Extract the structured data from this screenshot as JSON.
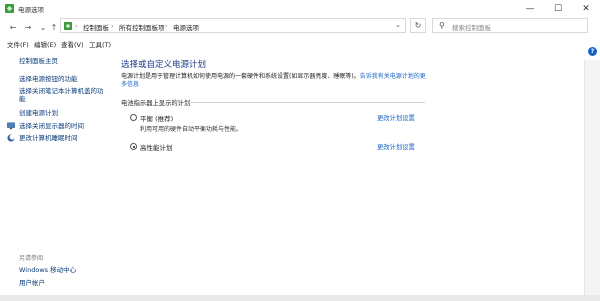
{
  "window": {
    "title": "电源选项"
  },
  "window_controls": {
    "minimize": "—",
    "maximize": "☐",
    "close": "✕"
  },
  "nav": {
    "back": "←",
    "forward": "→",
    "up_dropdown": "⌄",
    "up": "↑",
    "refresh": "↻",
    "address_dropdown": "⌄"
  },
  "breadcrumb": {
    "items": [
      "控制面板",
      "所有控制面板项",
      "电源选项"
    ],
    "separator": "›"
  },
  "search": {
    "placeholder": "搜索控制面板"
  },
  "menu": [
    "文件(F)",
    "编辑(E)",
    "查看(V)",
    "工具(T)"
  ],
  "sidebar": {
    "home": "控制面板主页",
    "links": [
      "选择电源按钮的功能",
      "选择关闭笔记本计算机盖的功能",
      "创建电源计划",
      "选择关闭显示器的时间",
      "更改计算机睡眠时间"
    ],
    "see_also_heading": "另请参阅",
    "see_also": [
      "Windows 移动中心",
      "用户帐户"
    ]
  },
  "main": {
    "title": "选择或自定义电源计划",
    "description": "电源计划是用于管理计算机如何使用电源的一套硬件和系统设置(如显示器亮度、睡眠等)。",
    "description_link": "告诉我有关电源计划的更多信息",
    "section_header": "电池指示器上显示的计划",
    "plans": [
      {
        "name": "平衡 (推荐)",
        "desc": "利用可用的硬件自动平衡功耗与性能。",
        "link": "更改计划设置",
        "selected": false
      },
      {
        "name": "高性能计划",
        "desc": "",
        "link": "更改计划设置",
        "selected": true
      }
    ]
  },
  "help": {
    "label": "?"
  },
  "colors": {
    "link": "#1663c7",
    "title": "#1e3a8a",
    "sidebar_link": "#0a3b7a"
  },
  "icons": [
    "control-panel-icon",
    "shield-icon",
    "monitor-icon",
    "moon-icon",
    "search-icon"
  ]
}
